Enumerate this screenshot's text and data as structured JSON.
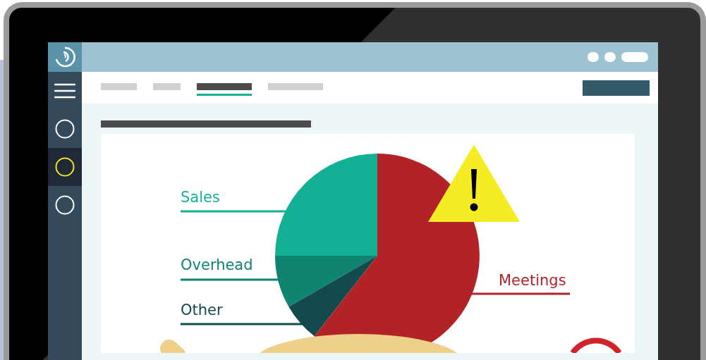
{
  "sidebar": {
    "items": [
      {
        "kind": "menu",
        "selected": false
      },
      {
        "kind": "circle",
        "selected": false
      },
      {
        "kind": "circle",
        "selected": true
      },
      {
        "kind": "circle",
        "selected": false
      }
    ]
  },
  "tabs": [
    {
      "selected": false
    },
    {
      "selected": false
    },
    {
      "selected": true
    },
    {
      "selected": false
    }
  ],
  "chart": {
    "segments": [
      {
        "label": "Sales",
        "color": "#14b095"
      },
      {
        "label": "Overhead",
        "color": "#0e8471"
      },
      {
        "label": "Other",
        "color": "#134a4e"
      },
      {
        "label": "Meetings",
        "color": "#b22328"
      }
    ]
  }
}
